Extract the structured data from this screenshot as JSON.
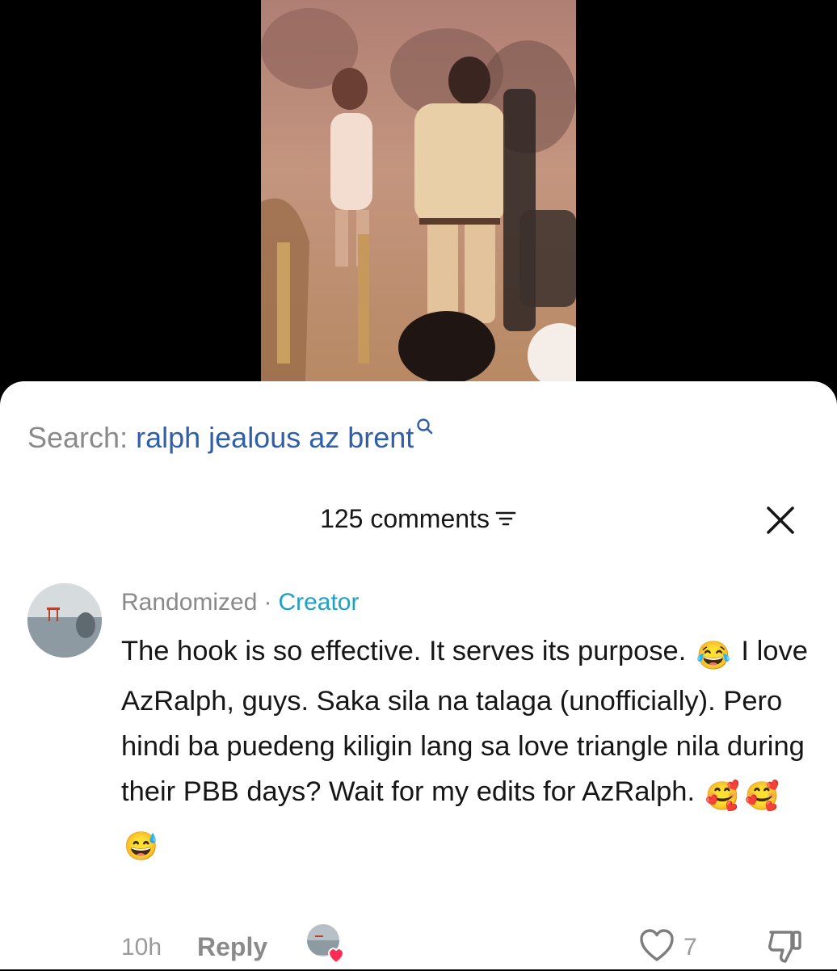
{
  "search": {
    "prefix": "Search:",
    "term": "ralph jealous az brent",
    "icon": "search-icon"
  },
  "comments_header": {
    "count_label": "125 comments",
    "filter_icon": "filter-icon",
    "close_icon": "close-icon"
  },
  "comment": {
    "author": "Randomized",
    "separator": "·",
    "badge": "Creator",
    "text_parts": [
      "The hook is so effective. It serves its purpose. ",
      " I love AzRalph, guys. Saka sila na talaga (unofficially). Pero hindi ba puedeng kiligin lang sa love triangle nila during their PBB days? Wait for my edits for AzRalph. "
    ],
    "emojis": [
      "😂",
      "🥰",
      "🥰",
      "😅"
    ],
    "time": "10h",
    "reply_label": "Reply",
    "like_count": "7"
  },
  "colors": {
    "accent_link": "#2f5fa8",
    "creator_badge": "#20a0c4",
    "heart_red": "#ff2d55",
    "muted_text": "#8a8a8a"
  }
}
